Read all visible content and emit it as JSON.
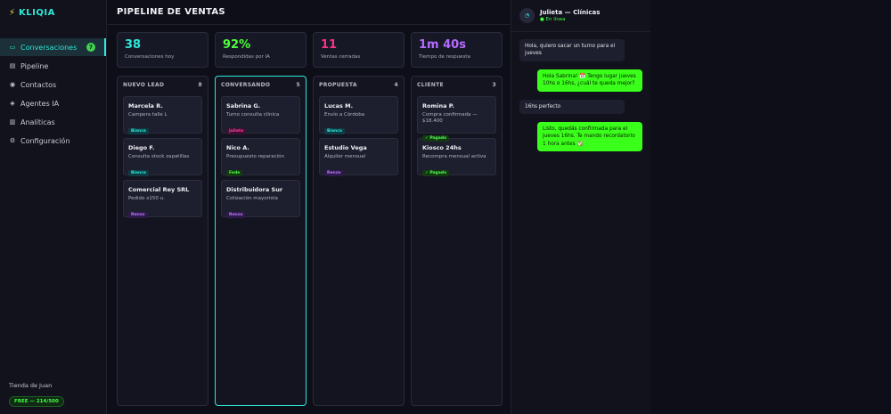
{
  "app": {
    "name": "KLIQIA",
    "logo_icon": "bolt-icon"
  },
  "sidebar": {
    "items": [
      {
        "label": "Conversaciones",
        "icon": "chat-icon",
        "glyph": "▭",
        "badge": "7",
        "active": true
      },
      {
        "label": "Pipeline",
        "icon": "pipeline-icon",
        "glyph": "▤"
      },
      {
        "label": "Contactos",
        "icon": "contacts-icon",
        "glyph": "◉"
      },
      {
        "label": "Agentes IA",
        "icon": "bot-icon",
        "glyph": "◈"
      },
      {
        "label": "Analíticas",
        "icon": "chart-icon",
        "glyph": "▥"
      },
      {
        "label": "Configuración",
        "icon": "gear-icon",
        "glyph": "⚙"
      }
    ],
    "store_name": "Tienda de Juan",
    "plan": "FREE — 214/500"
  },
  "main": {
    "title": "PIPELINE DE VENTAS",
    "stats": [
      {
        "value": "38",
        "label": "Conversaciones hoy",
        "color": "#2ee8d8"
      },
      {
        "value": "92%",
        "label": "Respondidas por IA",
        "color": "#4dff3a"
      },
      {
        "value": "11",
        "label": "Ventas cerradas",
        "color": "#ff2e8a"
      },
      {
        "value": "1m 40s",
        "label": "Tiempo de respuesta",
        "color": "#b36bff"
      }
    ],
    "columns": [
      {
        "title": "NUEVO LEAD",
        "count": "8",
        "cards": [
          {
            "name": "Marcela R.",
            "desc": "Campera talle L",
            "tag": "Bianca",
            "tag_style": "cyan"
          },
          {
            "name": "Diego F.",
            "desc": "Consulta stock zapatillas",
            "tag": "Bianca",
            "tag_style": "cyan"
          },
          {
            "name": "Comercial Rey SRL",
            "desc": "Pedido x150 u.",
            "tag": "Renzo",
            "tag_style": "purple"
          }
        ]
      },
      {
        "title": "CONVERSANDO",
        "count": "5",
        "active": true,
        "cards": [
          {
            "name": "Sabrina G.",
            "desc": "Turno consulta clínica",
            "tag": "Julieta",
            "tag_style": "pink"
          },
          {
            "name": "Nico A.",
            "desc": "Presupuesto reparación",
            "tag": "Fede",
            "tag_style": "green"
          },
          {
            "name": "Distribuidora Sur",
            "desc": "Cotización mayorista",
            "tag": "Renzo",
            "tag_style": "purple"
          }
        ]
      },
      {
        "title": "PROPUESTA",
        "count": "4",
        "cards": [
          {
            "name": "Lucas M.",
            "desc": "Envío a Córdoba",
            "tag": "Bianca",
            "tag_style": "cyan"
          },
          {
            "name": "Estudio Vega",
            "desc": "Alquiler mensual",
            "tag": "Renzo",
            "tag_style": "purple"
          }
        ]
      },
      {
        "title": "CLIENTE",
        "count": "3",
        "cards": [
          {
            "name": "Romina P.",
            "desc": "Compra confirmada — $18.400",
            "tag": "✓ Pagado",
            "tag_style": "green"
          },
          {
            "name": "Kiosco 24hs",
            "desc": "Recompra mensual activa",
            "tag": "✓ Pagado",
            "tag_style": "green"
          }
        ]
      }
    ]
  },
  "chat": {
    "title": "Julieta — Clínicas",
    "status": "● En línea",
    "messages": [
      {
        "from": "in",
        "text": "Hola, quiero sacar un turno para el jueves"
      },
      {
        "from": "out",
        "text": "Hola Sabrina! 📅 Tengo lugar jueves 10hs o 16hs, ¿cuál te queda mejor?"
      },
      {
        "from": "in",
        "text": "16hs perfecto"
      },
      {
        "from": "out",
        "text": "Listo, quedás confirmada para el jueves 16hs. Te mando recordatorio 1 hora antes ✅"
      }
    ]
  }
}
